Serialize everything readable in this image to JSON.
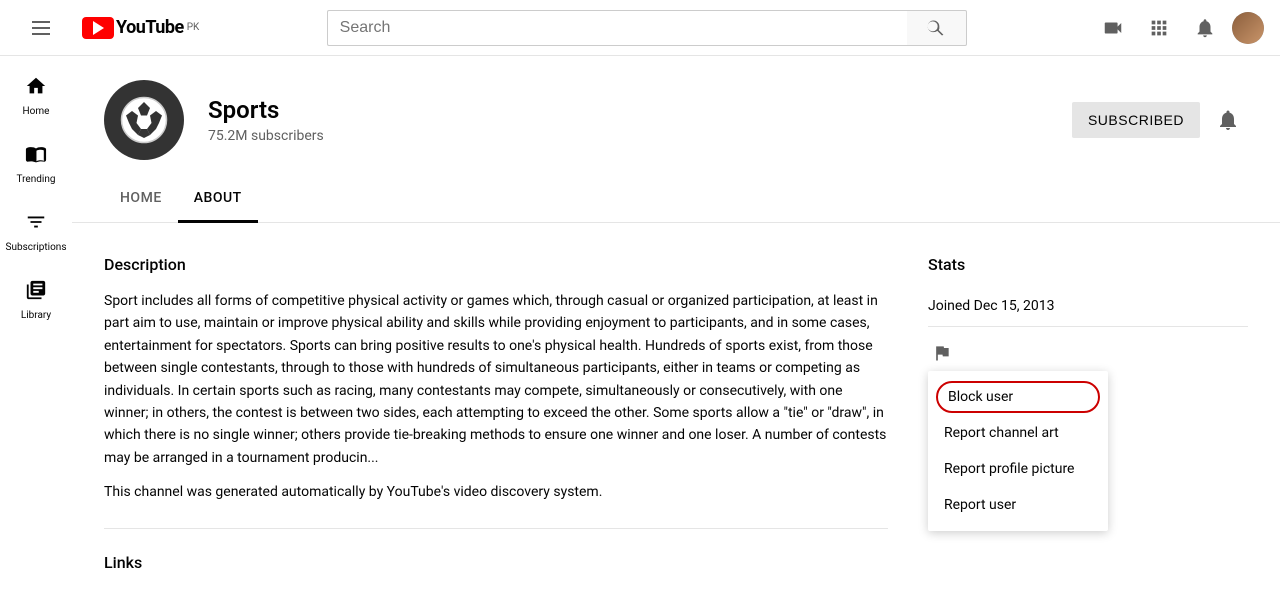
{
  "navbar": {
    "hamburger_label": "Menu",
    "logo_text": "YouTube",
    "logo_country": "PK",
    "search_placeholder": "Search",
    "search_btn_label": "Search",
    "icons": {
      "create": "video-create-icon",
      "apps": "apps-icon",
      "notifications": "notifications-icon"
    }
  },
  "sidebar": {
    "items": [
      {
        "id": "home",
        "label": "Home",
        "icon": "⌂"
      },
      {
        "id": "trending",
        "label": "Trending",
        "icon": "🔥"
      },
      {
        "id": "subscriptions",
        "label": "Subscriptions",
        "icon": "▦"
      },
      {
        "id": "library",
        "label": "Library",
        "icon": "📁"
      }
    ]
  },
  "channel": {
    "name": "Sports",
    "subscribers": "75.2M subscribers",
    "tab_home": "HOME",
    "tab_about": "ABOUT",
    "subscribed_label": "SUBSCRIBED"
  },
  "about": {
    "description_title": "Description",
    "description_text1": "Sport includes all forms of competitive physical activity or games which, through casual or organized participation, at least in part aim to use, maintain or improve physical ability and skills while providing enjoyment to participants, and in some cases, entertainment for spectators. Sports can bring positive results to one's physical health. Hundreds of sports exist, from those between single contestants, through to those with hundreds of simultaneous participants, either in teams or competing as individuals. In certain sports such as racing, many contestants may compete, simultaneously or consecutively, with one winner; in others, the contest is between two sides, each attempting to exceed the other. Some sports allow a \"tie\" or \"draw\", in which there is no single winner; others provide tie-breaking methods to ensure one winner and one loser. A number of contests may be arranged in a tournament producin...",
    "description_text2": "This channel was generated automatically by YouTube's video discovery system.",
    "links_title": "Links",
    "stats_title": "Stats",
    "joined": "Joined Dec 15, 2013"
  },
  "dropdown": {
    "items": [
      {
        "id": "block-user",
        "label": "Block user",
        "highlighted": true
      },
      {
        "id": "report-channel-art",
        "label": "Report channel art",
        "highlighted": false
      },
      {
        "id": "report-profile-picture",
        "label": "Report profile picture",
        "highlighted": false
      },
      {
        "id": "report-user",
        "label": "Report user",
        "highlighted": false
      }
    ]
  }
}
